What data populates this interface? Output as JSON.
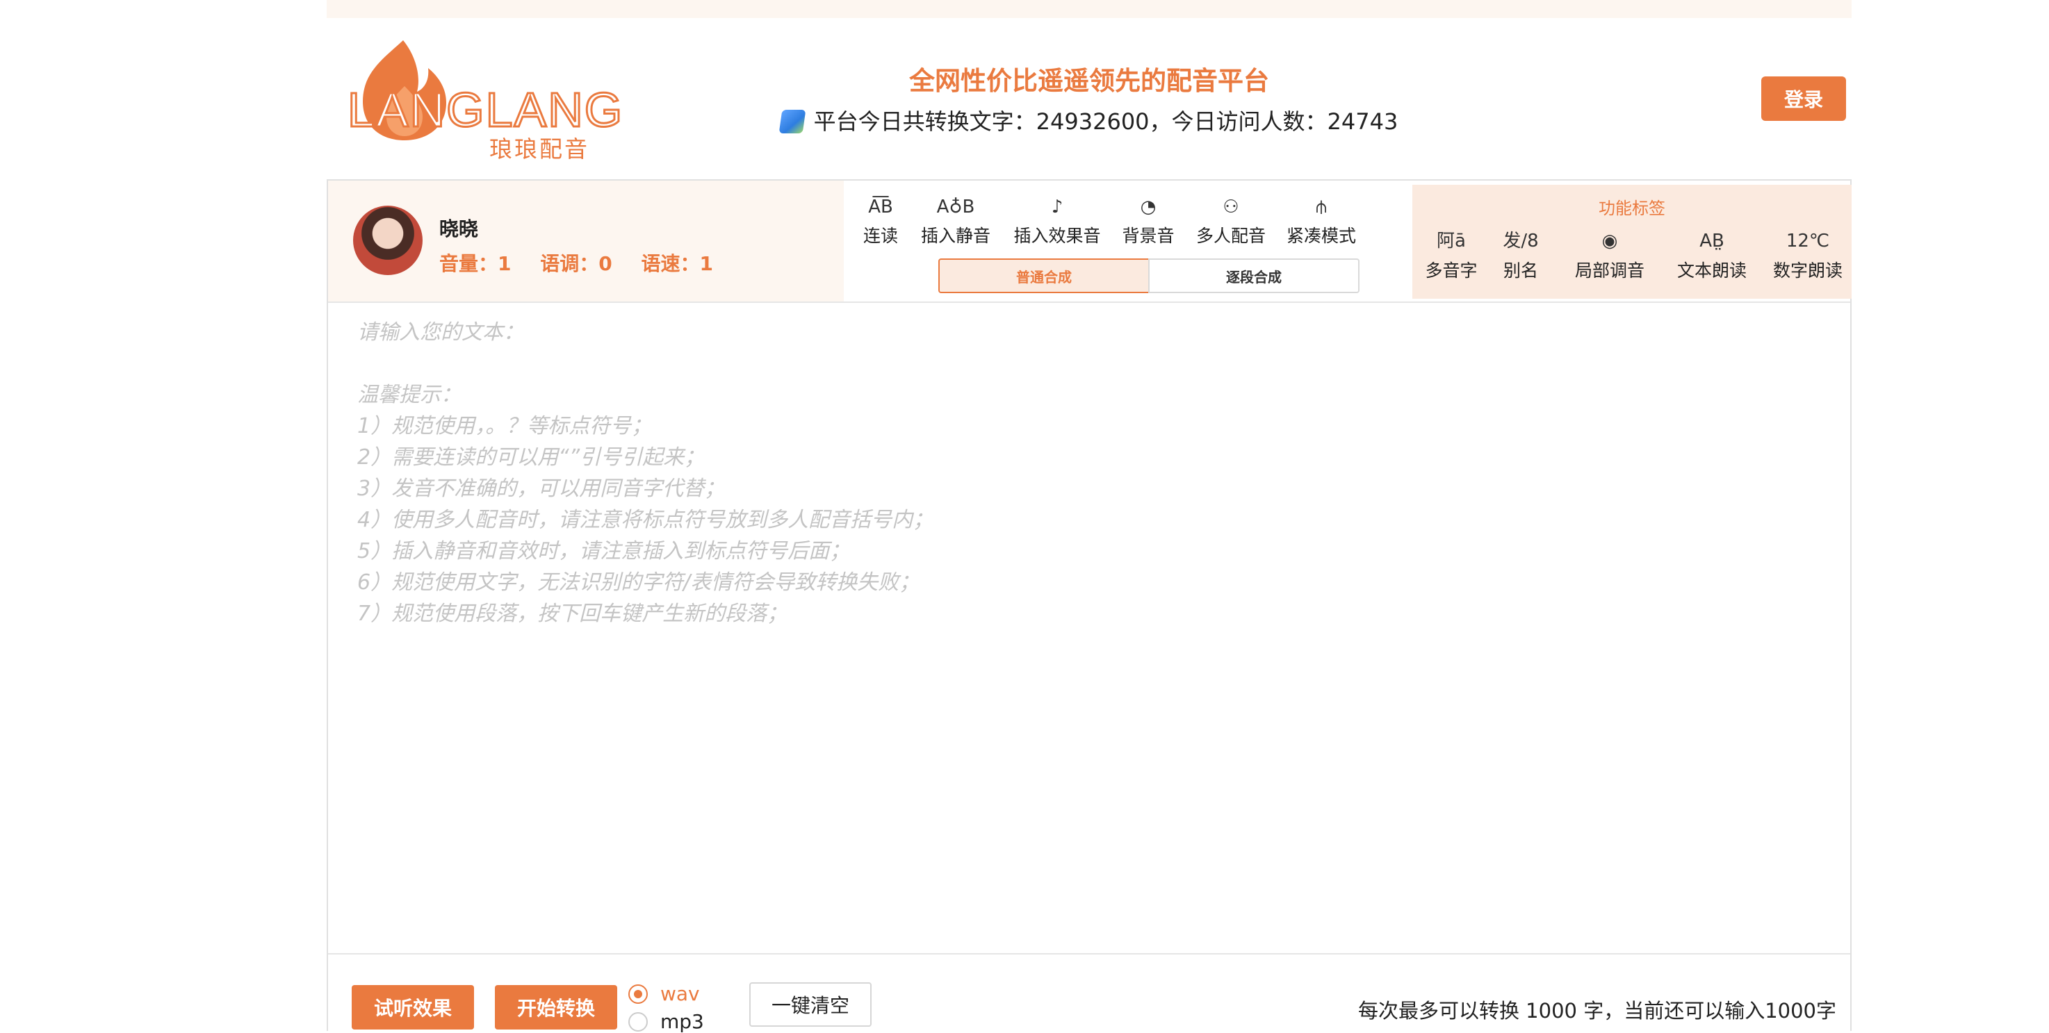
{
  "header": {
    "logo_text": "LANGLANG",
    "logo_subtitle": "琅琅配音",
    "slogan": "全网性价比遥遥领先的配音平台",
    "stats": "平台今日共转换文字：24932600，今日访问人数：24743",
    "login_label": "登录"
  },
  "voice": {
    "name": "晓晓",
    "volume": "音量：1",
    "pitch": "语调：0",
    "speed": "语速：1"
  },
  "tools": [
    {
      "label": "连读",
      "icon": "A͞B"
    },
    {
      "label": "插入静音",
      "icon": "A♁B"
    },
    {
      "label": "插入效果音",
      "icon": "♪"
    },
    {
      "label": "背景音",
      "icon": "◔"
    },
    {
      "label": "多人配音",
      "icon": "⚇"
    },
    {
      "label": "紧凑模式",
      "icon": "⫛"
    }
  ],
  "mode_tabs": [
    "普通合成",
    "逐段合成"
  ],
  "features": {
    "title": "功能标签",
    "items": [
      {
        "label": "多音字",
        "icon": "阿ā"
      },
      {
        "label": "别名",
        "icon": "发/8"
      },
      {
        "label": "局部调音",
        "icon": "◉"
      },
      {
        "label": "文本朗读",
        "icon": "AB̤"
      },
      {
        "label": "数字朗读",
        "icon": "12℃"
      }
    ]
  },
  "editor": {
    "placeholder": "请输入您的文本：\n\n温馨提示：\n1）规范使用，。？等标点符号；\n2）需要连读的可以用“”引号引起来；\n3）发音不准确的，可以用同音字代替；\n4）使用多人配音时，请注意将标点符号放到多人配音括号内；\n5）插入静音和音效时，请注意插入到标点符号后面；\n6）规范使用文字，无法识别的字符/表情符会导致转换失败；\n7）规范使用段落，按下回车键产生新的段落；",
    "value": ""
  },
  "footer": {
    "preview_label": "试听效果",
    "convert_label": "开始转换",
    "format_options": [
      "wav",
      "mp3"
    ],
    "selected_format": "wav",
    "clear_label": "一键清空",
    "limit_text": "每次最多可以转换 1000 字，当前还可以输入1000字"
  },
  "colors": {
    "accent": "#ea7a3f",
    "accent_light": "#fbeadf",
    "card_bg": "#fdf6f0"
  }
}
